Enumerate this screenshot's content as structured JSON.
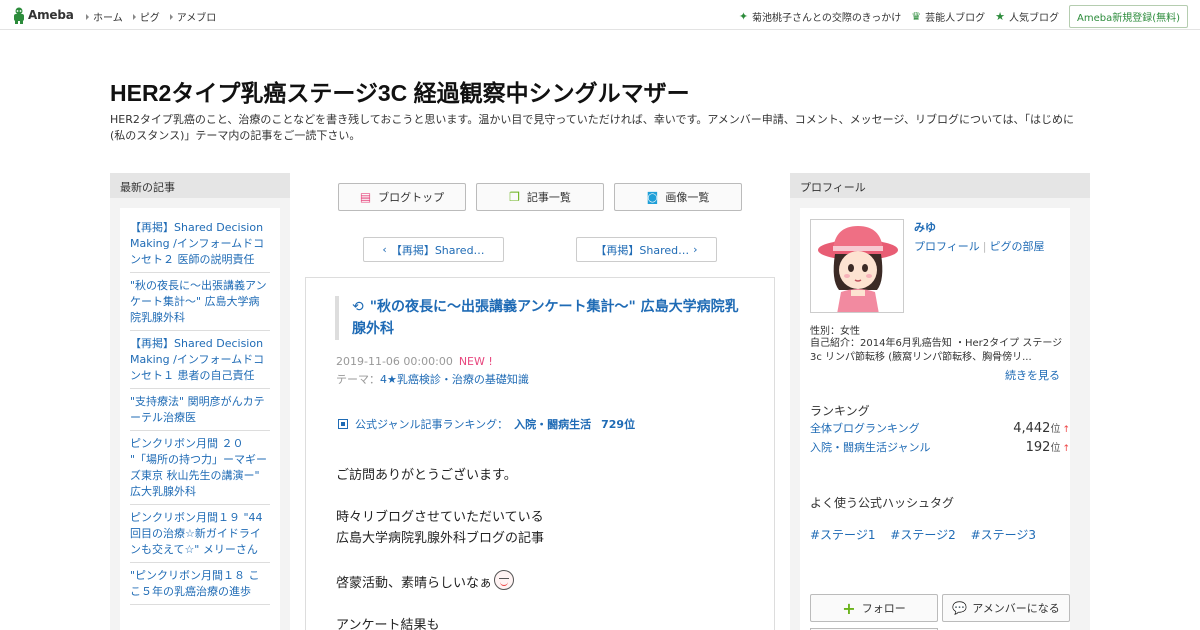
{
  "topbar": {
    "logo_text": "Ameba",
    "nav": [
      "ホーム",
      "ピグ",
      "アメブロ"
    ],
    "right_links": [
      {
        "icon": "sparkle-icon",
        "label": "菊池桃子さんとの交際のきっかけ"
      },
      {
        "icon": "crown-icon",
        "label": "芸能人ブログ"
      },
      {
        "icon": "star-icon",
        "label": "人気ブログ"
      }
    ],
    "signup_label": "Ameba新規登録(無料)"
  },
  "blog": {
    "title": "HER2タイプ乳癌ステージ3C 経過観察中シングルマザー",
    "description": "HER2タイプ乳癌のこと、治療のことなどを書き残しておこうと思います。温かい目で見守っていただければ、幸いです。アメンバー申請、コメント、メッセージ、リブログについては、「はじめに(私のスタンス)」テーマ内の記事をご一読下さい。"
  },
  "left_sidebar": {
    "heading": "最新の記事",
    "items": [
      "【再掲】Shared Decision Making /インフォームドコンセト２ 医師の説明責任",
      "\"秋の夜長に～出張講義アンケート集計～\" 広島大学病院乳腺外科",
      "【再掲】Shared Decision Making /インフォームドコンセト１ 患者の自己責任",
      "\"支持療法\" 関明彦がんカテーテル治療医",
      "ピンクリボン月間 ２０ \"「場所の持つ力」ーマギーズ東京 秋山先生の講演ー\" 広大乳腺外科",
      "ピンクリボン月間１９ \"44回目の治療☆新ガイドラインも交えて☆\" メリーさん",
      "\"ピンクリボン月間１８ ここ５年の乳癌治療の進歩"
    ]
  },
  "center": {
    "buttons": [
      {
        "icon": "document-icon",
        "label": "ブログトップ"
      },
      {
        "icon": "list-icon",
        "label": "記事一覧"
      },
      {
        "icon": "camera-icon",
        "label": "画像一覧"
      }
    ],
    "prev_label": "【再掲】Shared…",
    "next_label": "【再掲】Shared…",
    "article": {
      "title": "\"秋の夜長に～出張講義アンケート集計～\" 広島大学病院乳腺外科",
      "date": "2019-11-06 00:00:00",
      "new_badge": "NEW !",
      "theme_label": "テーマ：",
      "theme": "4★乳癌検診・治療の基礎知識",
      "ranking_label": "公式ジャンル記事ランキング：",
      "ranking_genre": "入院・闘病生活",
      "ranking_value": "729位",
      "body": {
        "p1": "ご訪問ありがとうございます。",
        "p2a": "時々リブログさせていただいている",
        "p2b": "広島大学病院乳腺外科ブログの記事",
        "p3": "啓蒙活動、素晴らしいなぁ",
        "p4": "アンケート結果も"
      }
    }
  },
  "right_sidebar": {
    "heading": "プロフィール",
    "name": "みゆ",
    "profile_link": "プロフィール",
    "pig_link": "ピグの部屋",
    "gender": "性別：女性",
    "intro": "自己紹介：2014年6月乳癌告知 ・Her2タイプ ステージ3c リンパ節転移 (腋窩リンパ節転移、胸骨傍リ...",
    "more_label": "続きを見る",
    "ranking_heading": "ランキング",
    "rankings": [
      {
        "label": "全体ブログランキング",
        "value": "4,442",
        "unit": "位",
        "trend": "↑"
      },
      {
        "label": "入院・闘病生活ジャンル",
        "value": "192",
        "unit": "位",
        "trend": "↑"
      }
    ],
    "hashtags_heading": "よく使う公式ハッシュタグ",
    "hashtags": [
      "#ステージ1",
      "#ステージ2",
      "#ステージ3"
    ],
    "follow_label": "フォロー",
    "amember_label": "アメンバーになる"
  },
  "colors": {
    "link": "#1f6bb5",
    "ameba_green": "#2d8c3c",
    "new_badge": "#e8487f"
  }
}
